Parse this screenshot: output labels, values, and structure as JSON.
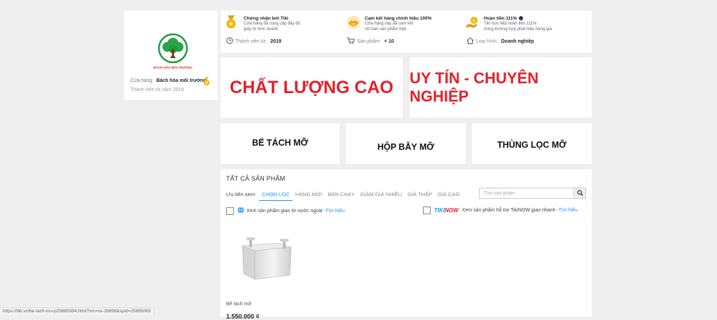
{
  "store": {
    "logo_text": "BÁCH HÓA MÔI TRƯỜNG",
    "name_label": "Cửa hàng:",
    "name": "Bách hóa môi trường",
    "member_since": "Thành viên từ năm 2019"
  },
  "info": {
    "certified": {
      "title": "Chứng nhận bởi Tiki",
      "desc1": "Cửa hàng đã cung cấp đầy đủ",
      "desc2": "giấy tờ kinh doanh"
    },
    "genuine": {
      "title": "Cam kết hàng chính hiệu 100%",
      "desc1": "Cửa hàng này đã cam kết",
      "desc2": "chỉ bán sản phẩm thật"
    },
    "refund": {
      "title": "Hoàn tiền 111%",
      "desc1": "Tiki trực tiếp hoàn tiền 111%",
      "desc2": "trong trường hợp phát hiện hàng giả"
    },
    "member": {
      "label": "Thành viên từ:",
      "value": "2019"
    },
    "products": {
      "label": "Sản phẩm:",
      "value": "< 10"
    },
    "type": {
      "label": "Loại hình:",
      "value": "Doanh nghiệp"
    }
  },
  "banners": {
    "quality": "CHẤT LƯỢNG CAO",
    "trust": "UY TÍN - CHUYÊN NGHIỆP"
  },
  "categories": [
    "BỂ TÁCH MỠ",
    "HỘP BẪY MỠ",
    "THÙNG LỌC MỠ"
  ],
  "products_panel": {
    "title": "TẤT CẢ SẢN PHẨM",
    "sort_label": "Ưu tiên xem:",
    "sort_tabs": [
      "CHỌN LỌC",
      "HÀNG MỚI",
      "BÁN CHẠY",
      "GIẢM GIÁ NHIỀU",
      "GIÁ THẤP",
      "GIÁ CAO"
    ],
    "active_tab": "CHỌN LỌC",
    "search_placeholder": "Tìm sản phẩm",
    "filter_foreign": {
      "text": "Xem sản phẩm giao từ nước ngoài - ",
      "link": "Tìm hiểu"
    },
    "filter_tikinow": {
      "brand_a": "TIKI",
      "brand_b": "NOW",
      "text": "Xem sản phẩm hỗ trợ TikiNOW giao nhanh - ",
      "link": "Tìm hiểu"
    },
    "product": {
      "name": "Bể tách mỡ",
      "price": "1.550.000 ₫"
    }
  },
  "status_bar": {
    "url": "https://tiki.vn/be-tach-mo-p25685084.html?src=ss-26696&spid=25685083"
  },
  "colors": {
    "accent": "#1a94ff",
    "banner_red": "#e4202a",
    "gold": "#f5b400"
  }
}
